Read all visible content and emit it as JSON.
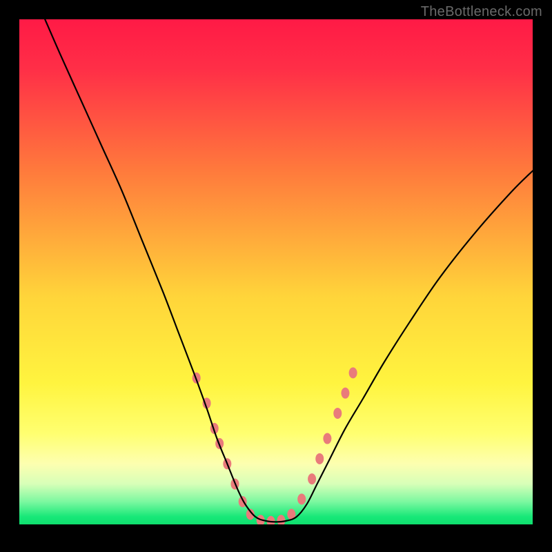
{
  "watermark": "TheBottleneck.com",
  "chart_data": {
    "type": "line",
    "title": "",
    "xlabel": "",
    "ylabel": "",
    "xlim": [
      0,
      100
    ],
    "ylim": [
      0,
      100
    ],
    "background_gradient": {
      "orientation": "vertical",
      "stops": [
        {
          "offset": 0.0,
          "color": "#ff1a46"
        },
        {
          "offset": 0.1,
          "color": "#ff2f47"
        },
        {
          "offset": 0.3,
          "color": "#ff7a3c"
        },
        {
          "offset": 0.55,
          "color": "#ffd53a"
        },
        {
          "offset": 0.72,
          "color": "#fff43f"
        },
        {
          "offset": 0.82,
          "color": "#ffff70"
        },
        {
          "offset": 0.88,
          "color": "#fdffb0"
        },
        {
          "offset": 0.92,
          "color": "#d7ffb8"
        },
        {
          "offset": 0.955,
          "color": "#7cf8a0"
        },
        {
          "offset": 0.985,
          "color": "#17e878"
        },
        {
          "offset": 1.0,
          "color": "#0fdf6e"
        }
      ]
    },
    "series": [
      {
        "name": "bottleneck-curve",
        "color": "#000000",
        "stroke_width": 2.2,
        "x": [
          5,
          8,
          12,
          16,
          20,
          24,
          28,
          31,
          34,
          36.5,
          38.5,
          40.5,
          42.5,
          44,
          46,
          48,
          50,
          52,
          54,
          56,
          58,
          60.5,
          63.5,
          67,
          71,
          76,
          82,
          89,
          96,
          100
        ],
        "y": [
          100,
          93,
          84,
          75,
          66,
          56,
          46,
          38,
          30,
          23,
          17,
          12,
          7,
          4,
          1.5,
          0.7,
          0.5,
          0.7,
          1.5,
          4,
          8,
          13,
          19,
          25,
          32,
          40,
          49,
          58,
          66,
          70
        ]
      }
    ],
    "markers": {
      "name": "highlight-dots",
      "color": "#e97b7b",
      "radius_x": 6,
      "radius_y": 8,
      "points": [
        {
          "x": 34.5,
          "y": 29
        },
        {
          "x": 36.5,
          "y": 24
        },
        {
          "x": 38.0,
          "y": 19
        },
        {
          "x": 39.0,
          "y": 16
        },
        {
          "x": 40.5,
          "y": 12
        },
        {
          "x": 42.0,
          "y": 8
        },
        {
          "x": 43.5,
          "y": 4.5
        },
        {
          "x": 45.0,
          "y": 2
        },
        {
          "x": 47.0,
          "y": 0.8
        },
        {
          "x": 49.0,
          "y": 0.6
        },
        {
          "x": 51.0,
          "y": 0.8
        },
        {
          "x": 53.0,
          "y": 2
        },
        {
          "x": 55.0,
          "y": 5
        },
        {
          "x": 57.0,
          "y": 9
        },
        {
          "x": 58.5,
          "y": 13
        },
        {
          "x": 60.0,
          "y": 17
        },
        {
          "x": 62.0,
          "y": 22
        },
        {
          "x": 63.5,
          "y": 26
        },
        {
          "x": 65.0,
          "y": 30
        }
      ]
    }
  }
}
